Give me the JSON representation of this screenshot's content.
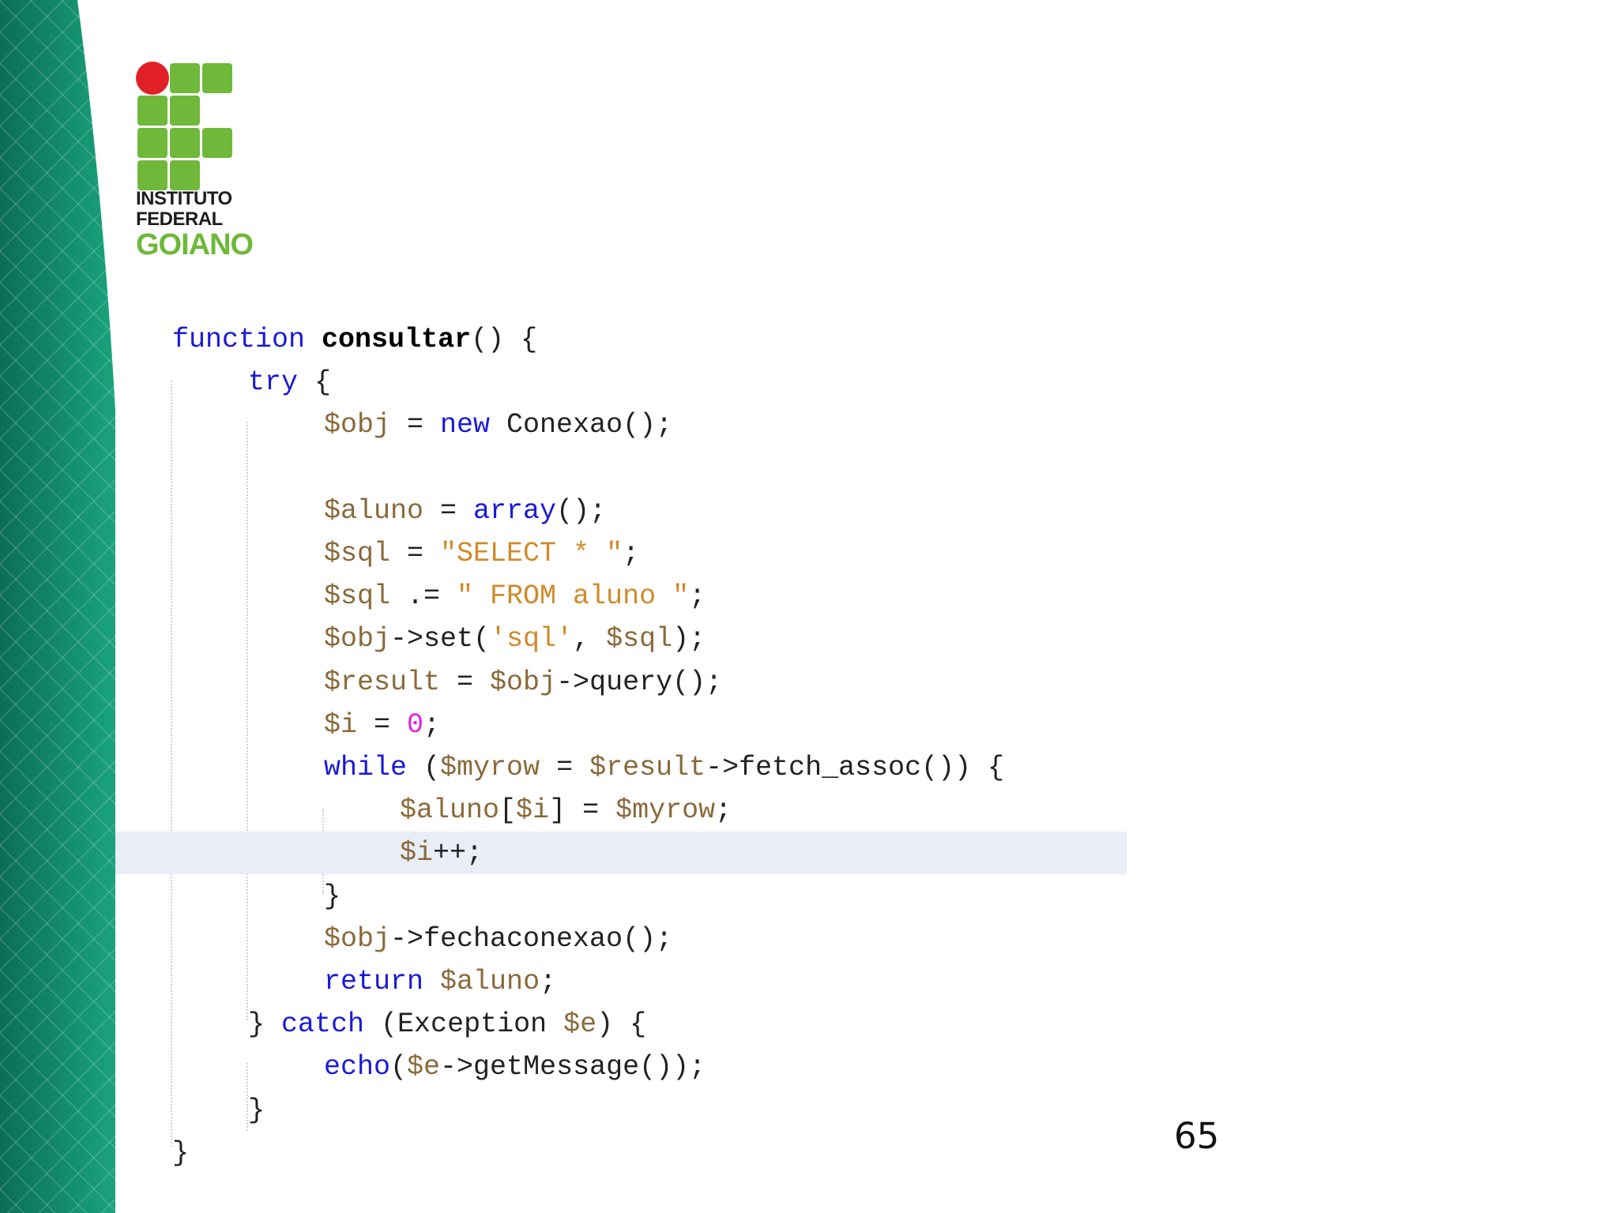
{
  "slide": {
    "page_number": "65"
  },
  "logo": {
    "line1": "INSTITUTO",
    "line2": "FEDERAL",
    "line3": "GOIANO"
  },
  "colors": {
    "band_dark": "#0b6e55",
    "band_light": "#1aa37d",
    "logo_green": "#6fb83a",
    "logo_red": "#e11f26",
    "keyword": "#1a1ad6",
    "variable": "#8a6a3a",
    "string": "#d08a2a",
    "number": "#e01ee0",
    "highlight_line": "#e8edf8"
  },
  "code": {
    "lines": [
      [
        {
          "t": "function",
          "c": "kw"
        },
        {
          "t": " ",
          "c": "plain"
        },
        {
          "t": "consultar",
          "c": "fn-name"
        },
        {
          "t": "() {",
          "c": "plain"
        }
      ],
      [
        {
          "t": "try",
          "c": "kw"
        },
        {
          "t": " {",
          "c": "plain"
        }
      ],
      [
        {
          "t": "$obj",
          "c": "var"
        },
        {
          "t": " = ",
          "c": "plain"
        },
        {
          "t": "new",
          "c": "kw"
        },
        {
          "t": " Conexao();",
          "c": "plain"
        }
      ],
      [],
      [
        {
          "t": "$aluno",
          "c": "var"
        },
        {
          "t": " = ",
          "c": "plain"
        },
        {
          "t": "array",
          "c": "kw"
        },
        {
          "t": "();",
          "c": "plain"
        }
      ],
      [
        {
          "t": "$sql",
          "c": "var"
        },
        {
          "t": " = ",
          "c": "plain"
        },
        {
          "t": "\"SELECT * \"",
          "c": "str"
        },
        {
          "t": ";",
          "c": "plain"
        }
      ],
      [
        {
          "t": "$sql",
          "c": "var"
        },
        {
          "t": " .= ",
          "c": "plain"
        },
        {
          "t": "\" FROM aluno \"",
          "c": "str"
        },
        {
          "t": ";",
          "c": "plain"
        }
      ],
      [
        {
          "t": "$obj",
          "c": "var"
        },
        {
          "t": "->set(",
          "c": "plain"
        },
        {
          "t": "'sql'",
          "c": "str"
        },
        {
          "t": ", ",
          "c": "plain"
        },
        {
          "t": "$sql",
          "c": "var"
        },
        {
          "t": ");",
          "c": "plain"
        }
      ],
      [
        {
          "t": "$result",
          "c": "var"
        },
        {
          "t": " = ",
          "c": "plain"
        },
        {
          "t": "$obj",
          "c": "var"
        },
        {
          "t": "->query();",
          "c": "plain"
        }
      ],
      [
        {
          "t": "$i",
          "c": "var"
        },
        {
          "t": " = ",
          "c": "plain"
        },
        {
          "t": "0",
          "c": "num"
        },
        {
          "t": ";",
          "c": "plain"
        }
      ],
      [
        {
          "t": "while",
          "c": "kw"
        },
        {
          "t": " (",
          "c": "plain"
        },
        {
          "t": "$myrow",
          "c": "var"
        },
        {
          "t": " = ",
          "c": "plain"
        },
        {
          "t": "$result",
          "c": "var"
        },
        {
          "t": "->fetch_assoc()) {",
          "c": "plain"
        }
      ],
      [
        {
          "t": "$aluno",
          "c": "var"
        },
        {
          "t": "[",
          "c": "plain"
        },
        {
          "t": "$i",
          "c": "var"
        },
        {
          "t": "] = ",
          "c": "plain"
        },
        {
          "t": "$myrow",
          "c": "var"
        },
        {
          "t": ";",
          "c": "plain"
        }
      ],
      [
        {
          "t": "$i",
          "c": "var"
        },
        {
          "t": "++;",
          "c": "plain"
        }
      ],
      [
        {
          "t": "}",
          "c": "plain"
        }
      ],
      [
        {
          "t": "$obj",
          "c": "var"
        },
        {
          "t": "->fechaconexao();",
          "c": "plain"
        }
      ],
      [
        {
          "t": "return",
          "c": "kw"
        },
        {
          "t": " ",
          "c": "plain"
        },
        {
          "t": "$aluno",
          "c": "var"
        },
        {
          "t": ";",
          "c": "plain"
        }
      ],
      [
        {
          "t": "} ",
          "c": "plain"
        },
        {
          "t": "catch",
          "c": "kw"
        },
        {
          "t": " (Exception ",
          "c": "plain"
        },
        {
          "t": "$e",
          "c": "var"
        },
        {
          "t": ") {",
          "c": "plain"
        }
      ],
      [
        {
          "t": "echo",
          "c": "kw"
        },
        {
          "t": "(",
          "c": "plain"
        },
        {
          "t": "$e",
          "c": "var"
        },
        {
          "t": "->getMessage());",
          "c": "plain"
        }
      ],
      [
        {
          "t": "}",
          "c": "plain"
        }
      ],
      [
        {
          "t": "}",
          "c": "plain"
        }
      ]
    ]
  }
}
